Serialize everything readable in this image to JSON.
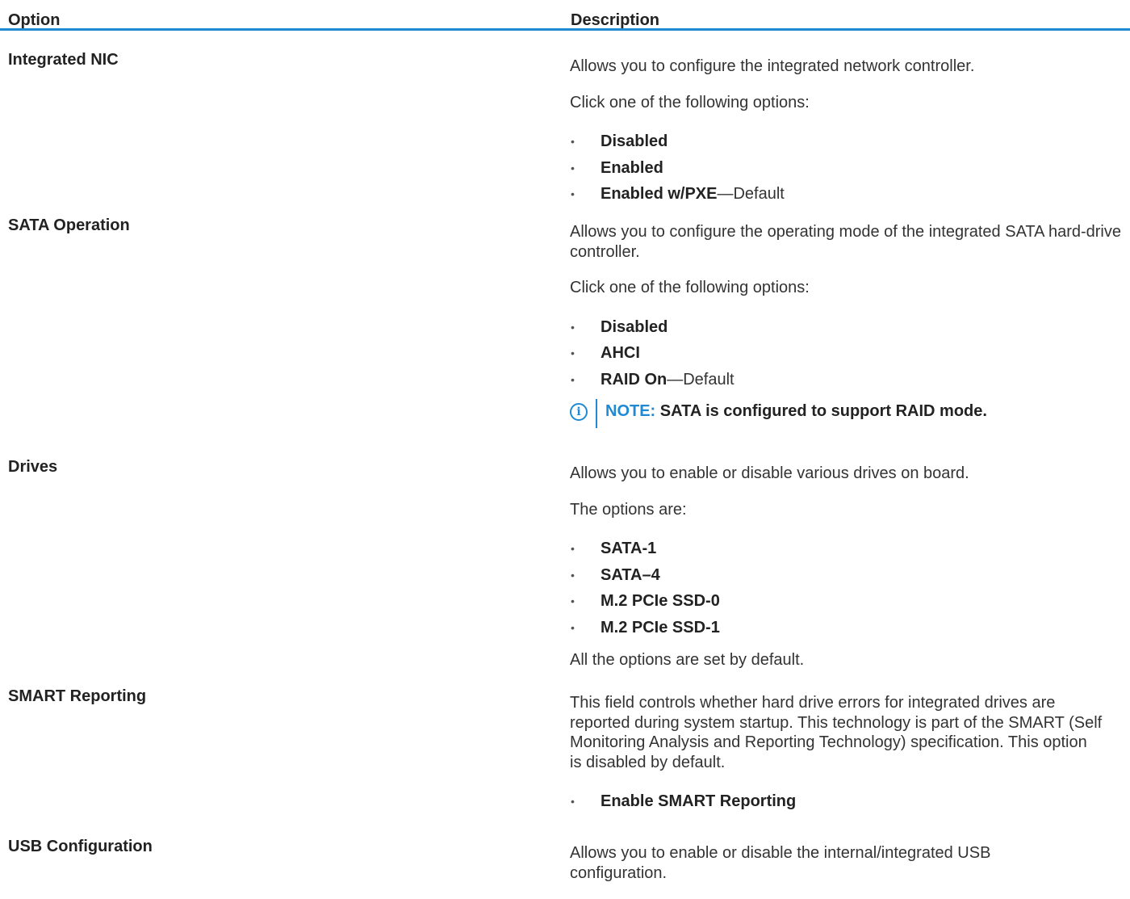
{
  "header": {
    "option": "Option",
    "description": "Description"
  },
  "rows": [
    {
      "name": "Integrated NIC",
      "intro": "Allows you to configure the integrated network controller.",
      "prompt": "Click one of the following options:",
      "options": [
        {
          "label": "Disabled",
          "suffix": ""
        },
        {
          "label": "Enabled",
          "suffix": ""
        },
        {
          "label": "Enabled w/PXE",
          "suffix": "—Default"
        }
      ]
    },
    {
      "name": "SATA Operation",
      "intro": "Allows you to configure the operating mode of the integrated SATA hard-drive controller.",
      "prompt": "Click one of the following options:",
      "options": [
        {
          "label": "Disabled",
          "suffix": ""
        },
        {
          "label": "AHCI",
          "suffix": ""
        },
        {
          "label": "RAID On",
          "suffix": "—Default"
        }
      ],
      "note": {
        "label": "NOTE:",
        "text": "SATA is configured to support RAID mode.",
        "icon": "info-icon",
        "color": "#1f8ad2"
      }
    },
    {
      "name": "Drives",
      "intro": "Allows you to enable or disable various drives on board.",
      "prompt": "The options are:",
      "options": [
        {
          "label": "SATA-1",
          "suffix": ""
        },
        {
          "label": "SATA–4",
          "suffix": ""
        },
        {
          "label": "M.2 PCIe SSD-0",
          "suffix": ""
        },
        {
          "label": "M.2 PCIe SSD-1",
          "suffix": ""
        }
      ],
      "footer": "All the options are set by default."
    },
    {
      "name": "SMART Reporting",
      "intro": "This field controls whether hard drive errors for integrated drives are reported during system startup. This technology is part of the SMART (Self Monitoring Analysis and Reporting Technology) specification. This option is disabled by default.",
      "options": [
        {
          "label": "Enable SMART Reporting",
          "suffix": ""
        }
      ]
    },
    {
      "name": "USB Configuration",
      "intro": "Allows you to enable or disable the internal/integrated USB configuration."
    }
  ],
  "accent_color": "#1f8ad2"
}
